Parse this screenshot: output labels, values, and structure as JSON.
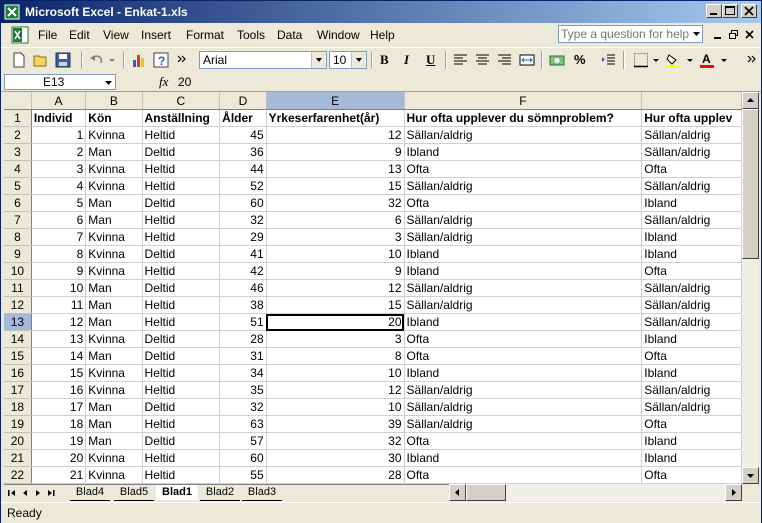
{
  "window": {
    "title": "Microsoft Excel - Enkat-1.xls"
  },
  "menu": [
    "File",
    "Edit",
    "View",
    "Insert",
    "Format",
    "Tools",
    "Data",
    "Window",
    "Help"
  ],
  "help_box": {
    "placeholder": "Type a question for help"
  },
  "toolbar": {
    "font": "Arial",
    "size": "10",
    "bold": "B",
    "italic": "I",
    "underline": "U",
    "percent": "%"
  },
  "formula_bar": {
    "name_box": "E13",
    "fx": "fx",
    "value": "20"
  },
  "columns": [
    "A",
    "B",
    "C",
    "D",
    "E",
    "F",
    ""
  ],
  "header_row": [
    "Individ",
    "Kön",
    "Anställning",
    "Ålder",
    "Yrkeserfarenhet(år)",
    "Hur ofta upplever du sömnproblem?",
    "Hur ofta upplev"
  ],
  "rows": [
    [
      "1",
      "Kvinna",
      "Heltid",
      "45",
      "12",
      "Sällan/aldrig",
      "Sällan/aldrig"
    ],
    [
      "2",
      "Man",
      "Deltid",
      "36",
      "9",
      "Ibland",
      "Sällan/aldrig"
    ],
    [
      "3",
      "Kvinna",
      "Heltid",
      "44",
      "13",
      "Ofta",
      "Ofta"
    ],
    [
      "4",
      "Kvinna",
      "Heltid",
      "52",
      "15",
      "Sällan/aldrig",
      "Sällan/aldrig"
    ],
    [
      "5",
      "Man",
      "Deltid",
      "60",
      "32",
      "Ofta",
      "Ibland"
    ],
    [
      "6",
      "Man",
      "Heltid",
      "32",
      "6",
      "Sällan/aldrig",
      "Sällan/aldrig"
    ],
    [
      "7",
      "Kvinna",
      "Heltid",
      "29",
      "3",
      "Sällan/aldrig",
      "Ibland"
    ],
    [
      "8",
      "Kvinna",
      "Deltid",
      "41",
      "10",
      "Ibland",
      "Ibland"
    ],
    [
      "9",
      "Kvinna",
      "Heltid",
      "42",
      "9",
      "Ibland",
      "Ofta"
    ],
    [
      "10",
      "Man",
      "Deltid",
      "46",
      "12",
      "Sällan/aldrig",
      "Sällan/aldrig"
    ],
    [
      "11",
      "Man",
      "Heltid",
      "38",
      "15",
      "Sällan/aldrig",
      "Sällan/aldrig"
    ],
    [
      "12",
      "Man",
      "Heltid",
      "51",
      "20",
      "Ibland",
      "Sällan/aldrig"
    ],
    [
      "13",
      "Kvinna",
      "Deltid",
      "28",
      "3",
      "Ofta",
      "Ibland"
    ],
    [
      "14",
      "Man",
      "Deltid",
      "31",
      "8",
      "Ofta",
      "Ofta"
    ],
    [
      "15",
      "Kvinna",
      "Heltid",
      "34",
      "10",
      "Ibland",
      "Ibland"
    ],
    [
      "16",
      "Kvinna",
      "Heltid",
      "35",
      "12",
      "Sällan/aldrig",
      "Sällan/aldrig"
    ],
    [
      "17",
      "Man",
      "Deltid",
      "32",
      "10",
      "Sällan/aldrig",
      "Sällan/aldrig"
    ],
    [
      "18",
      "Man",
      "Heltid",
      "63",
      "39",
      "Sällan/aldrig",
      "Ofta"
    ],
    [
      "19",
      "Man",
      "Deltid",
      "57",
      "32",
      "Ofta",
      "Ibland"
    ],
    [
      "20",
      "Kvinna",
      "Heltid",
      "60",
      "30",
      "Ibland",
      "Ibland"
    ],
    [
      "21",
      "Kvinna",
      "Heltid",
      "55",
      "28",
      "Ofta",
      "Ofta"
    ]
  ],
  "active_cell": {
    "row": 13,
    "col": 4
  },
  "sheet_tabs": [
    "Blad4",
    "Blad5",
    "Blad1",
    "Blad2",
    "Blad3"
  ],
  "active_tab": "Blad1",
  "status": "Ready",
  "colors": {
    "title_start": "#0a246a",
    "title_end": "#a6caf0",
    "selected_header": "#a6b9d8"
  }
}
